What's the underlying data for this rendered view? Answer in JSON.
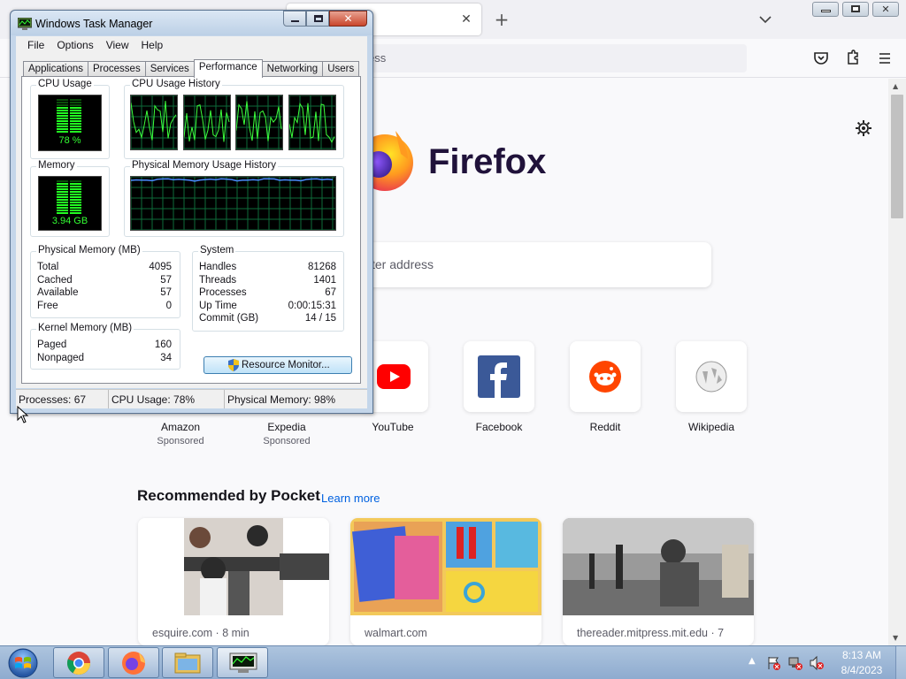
{
  "firefox": {
    "urlbar_text": "ess",
    "wordmark": "Firefox",
    "search_placeholder": "ter address",
    "tiles": [
      {
        "label": "Amazon",
        "sub": "Sponsored"
      },
      {
        "label": "Expedia",
        "sub": "Sponsored"
      },
      {
        "label": "YouTube",
        "sub": ""
      },
      {
        "label": "Facebook",
        "sub": ""
      },
      {
        "label": "Reddit",
        "sub": ""
      },
      {
        "label": "Wikipedia",
        "sub": ""
      }
    ],
    "pocket": {
      "title": "Recommended by Pocket",
      "learn_more": "Learn more",
      "cards": [
        {
          "source": "esquire.com · 8 min"
        },
        {
          "source": "walmart.com"
        },
        {
          "source": "thereader.mitpress.mit.edu · 7"
        }
      ]
    },
    "colors": {
      "accent": "#0061e0",
      "wordmark": "#20123a"
    }
  },
  "taskmgr": {
    "title": "Windows Task Manager",
    "menu": [
      "File",
      "Options",
      "View",
      "Help"
    ],
    "tabs": [
      "Applications",
      "Processes",
      "Services",
      "Performance",
      "Networking",
      "Users"
    ],
    "active_tab": "Performance",
    "cpu": {
      "title": "CPU Usage",
      "value": "78 %",
      "level": 0.78
    },
    "cpu_history": {
      "title": "CPU Usage History"
    },
    "memory": {
      "title": "Memory",
      "value": "3.94 GB",
      "level": 0.98
    },
    "mem_history": {
      "title": "Physical Memory Usage History"
    },
    "physical_memory": {
      "title": "Physical Memory (MB)",
      "rows": [
        {
          "k": "Total",
          "v": "4095"
        },
        {
          "k": "Cached",
          "v": "57"
        },
        {
          "k": "Available",
          "v": "57"
        },
        {
          "k": "Free",
          "v": "0"
        }
      ]
    },
    "kernel_memory": {
      "title": "Kernel Memory (MB)",
      "rows": [
        {
          "k": "Paged",
          "v": "160"
        },
        {
          "k": "Nonpaged",
          "v": "34"
        }
      ]
    },
    "system": {
      "title": "System",
      "rows": [
        {
          "k": "Handles",
          "v": "81268"
        },
        {
          "k": "Threads",
          "v": "1401"
        },
        {
          "k": "Processes",
          "v": "67"
        },
        {
          "k": "Up Time",
          "v": "0:00:15:31"
        },
        {
          "k": "Commit (GB)",
          "v": "14 / 15"
        }
      ]
    },
    "resource_monitor_label": "Resource Monitor...",
    "status": {
      "processes": "Processes: 67",
      "cpu": "CPU Usage: 78%",
      "memory": "Physical Memory: 98%"
    }
  },
  "taskbar": {
    "time": "8:13 AM",
    "date": "8/4/2023",
    "apps": [
      "chrome-icon",
      "firefox-icon",
      "explorer-icon",
      "task-manager-icon"
    ]
  }
}
